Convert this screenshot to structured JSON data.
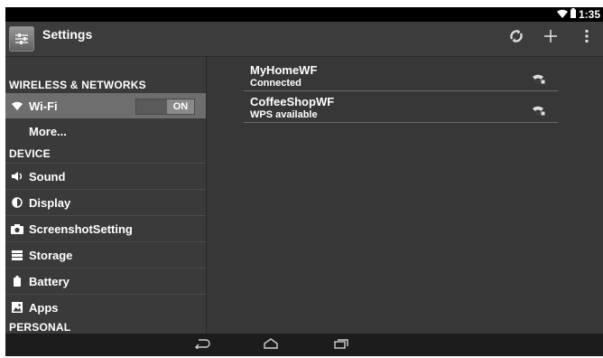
{
  "status_bar": {
    "time": "1:35"
  },
  "action_bar": {
    "title": "Settings",
    "actions": [
      "sync-icon",
      "add-icon",
      "overflow-menu-icon"
    ]
  },
  "sidebar": {
    "wireless_header": "WIRELESS & NETWORKS",
    "wifi": {
      "label": "Wi-Fi",
      "toggle": "ON"
    },
    "more_label": "More...",
    "device_header": "DEVICE",
    "items": [
      {
        "label": "Sound",
        "icon": "speaker-icon"
      },
      {
        "label": "Display",
        "icon": "brightness-icon"
      },
      {
        "label": "ScreenshotSetting",
        "icon": "camera-icon"
      },
      {
        "label": "Storage",
        "icon": "storage-icon"
      },
      {
        "label": "Battery",
        "icon": "battery-icon"
      },
      {
        "label": "Apps",
        "icon": "apps-icon"
      }
    ],
    "personal_header": "PERSONAL"
  },
  "networks": [
    {
      "name": "MyHomeWF",
      "status": "Connected"
    },
    {
      "name": "CoffeeShopWF",
      "status": "WPS available"
    }
  ],
  "colors": {
    "selected_row": "#6e6e6e",
    "screen_bg": "#373737",
    "status_bar": "#000000"
  }
}
